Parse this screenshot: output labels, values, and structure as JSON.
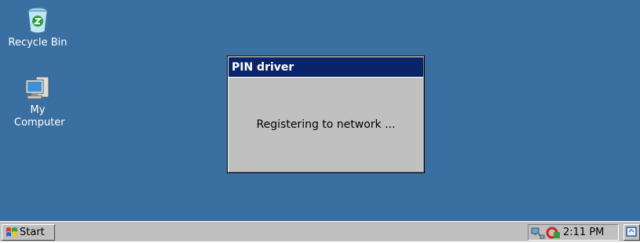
{
  "desktop": {
    "background": "#3a6fa1",
    "icons": [
      {
        "label": "Recycle Bin",
        "icon": "recycle-bin-icon"
      },
      {
        "label": "My Computer",
        "icon": "my-computer-icon"
      }
    ]
  },
  "dialog": {
    "title": "PIN driver",
    "message": "Registering to network ...",
    "title_color": "#0a246a"
  },
  "taskbar": {
    "start_label": "Start",
    "clock": "2:11 PM",
    "tray_icons": [
      "network-icon",
      "pin-driver-icon"
    ],
    "show_desktop_icon": "show-desktop-icon"
  }
}
